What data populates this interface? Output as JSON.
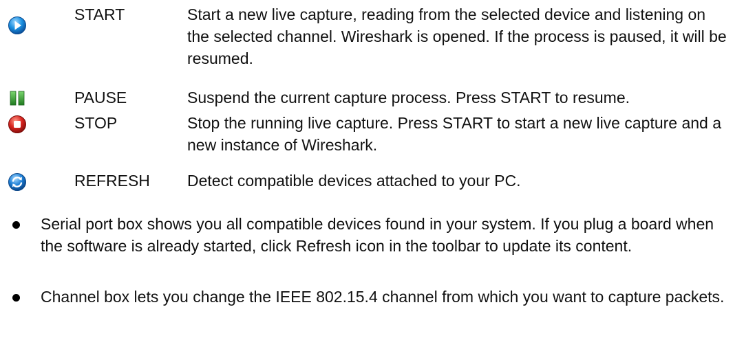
{
  "tools": [
    {
      "name": "START",
      "icon": "play-icon",
      "description": "Start a new live capture, reading from the selected device and listening on the selected channel. Wireshark is opened. If the process is paused, it will be resumed."
    },
    {
      "name": "PAUSE",
      "icon": "pause-icon",
      "description": "Suspend the current capture process. Press START to resume."
    },
    {
      "name": "STOP",
      "icon": "stop-icon",
      "description": "Stop the running live capture. Press START to start a new live capture and a new instance of Wireshark."
    },
    {
      "name": "REFRESH",
      "icon": "refresh-icon",
      "description": "Detect compatible devices attached to your PC."
    }
  ],
  "bullets": [
    "Serial port box shows you all compatible devices found in your system. If you plug a board when the software is already started, click Refresh icon in the toolbar to update its content.",
    "Channel box lets you change the IEEE 802.15.4 channel from which you want to capture packets."
  ],
  "colors": {
    "play": "#1a8fe0",
    "pause": "#2e9a2e",
    "stop": "#d8241f",
    "refresh": "#1d7fd6",
    "text": "#111111"
  }
}
